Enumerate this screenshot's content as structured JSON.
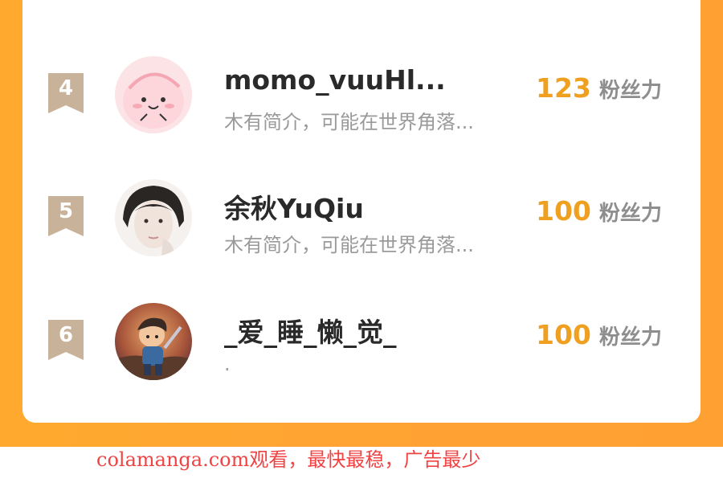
{
  "leaderboard": {
    "rows": [
      {
        "rank": "4",
        "name": "momo_vuuHl...",
        "bio": "木有简介，可能在世界角落...",
        "score": "123",
        "unit": "粉丝力",
        "avatar": "pink-cartoon-avatar"
      },
      {
        "rank": "5",
        "name": "余秋YuQiu",
        "bio": "木有简介，可能在世界角落...",
        "score": "100",
        "unit": "粉丝力",
        "avatar": "person-photo-avatar"
      },
      {
        "rank": "6",
        "name": "_爱_睡_懒_觉_",
        "bio": ".",
        "score": "100",
        "unit": "粉丝力",
        "avatar": "game-character-avatar"
      }
    ]
  },
  "watermark": "colamanga.com观看，最快最稳，广告最少",
  "colors": {
    "frame": "#ffa333",
    "score": "#f0a020",
    "rank_badge": "#c9b29a",
    "watermark": "#ee4444"
  }
}
